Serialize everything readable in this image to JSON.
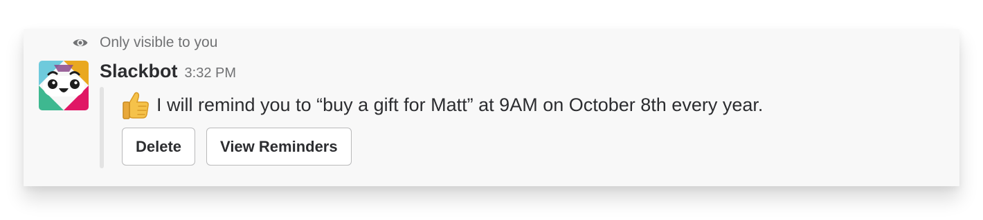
{
  "visibility": {
    "icon": "eye-icon",
    "text": "Only visible to you"
  },
  "message": {
    "avatar": "slackbot-avatar",
    "sender": "Slackbot",
    "time": "3:32 PM",
    "emoji": "thumbs-up-icon",
    "text": "I will remind you to “buy a gift for Matt” at 9AM on October 8th every year."
  },
  "actions": {
    "delete_label": "Delete",
    "view_label": "View Reminders"
  },
  "colors": {
    "card_background": "#f8f8f8",
    "text": "#2c2d30",
    "muted_text": "#717274",
    "attachment_bar": "#e3e3e3",
    "button_border": "#b9b9ba"
  }
}
